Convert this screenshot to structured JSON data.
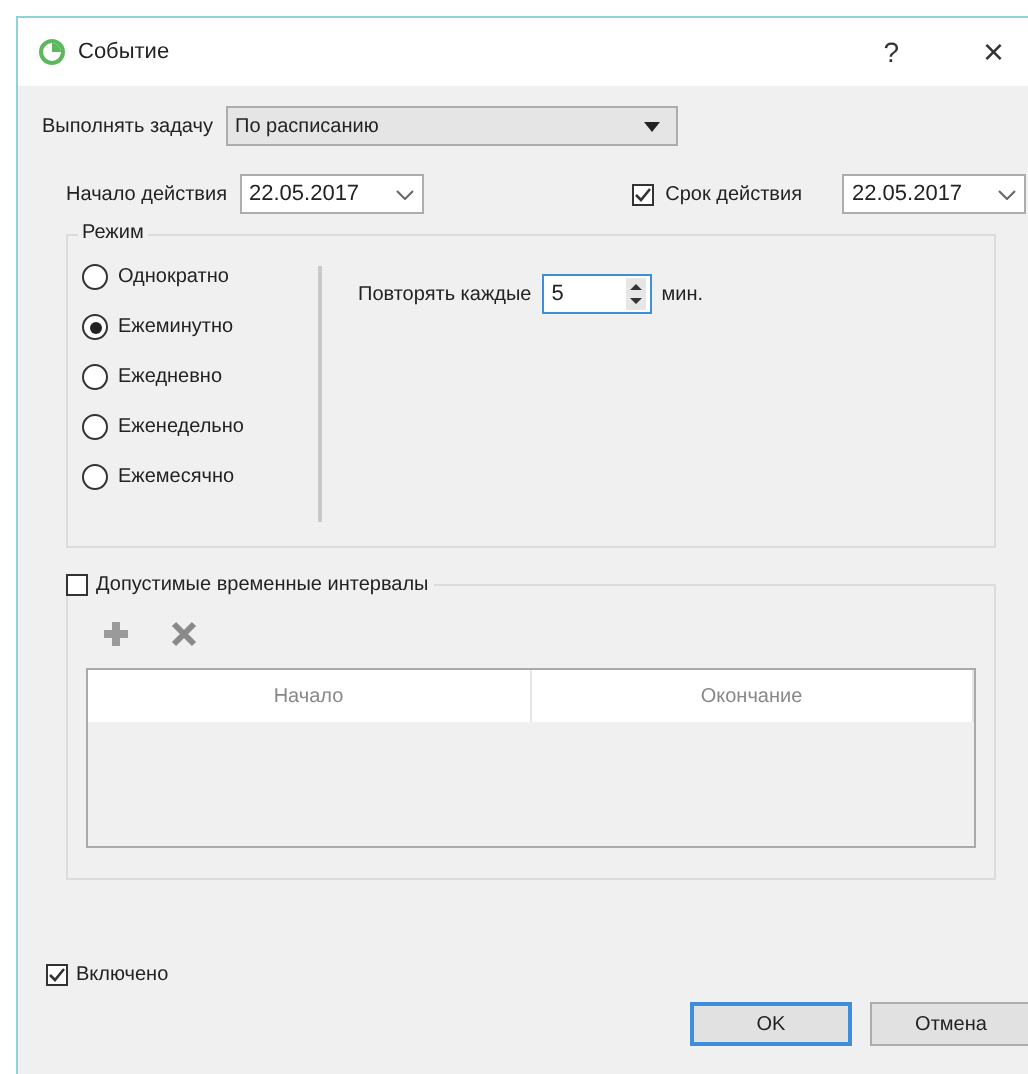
{
  "window": {
    "title": "Событие"
  },
  "title_buttons": [
    "?",
    "×"
  ],
  "task": {
    "label": "Выполнять задачу",
    "value": "По расписанию"
  },
  "start": {
    "label": "Начало действия",
    "value": "22.05.2017"
  },
  "expiry": {
    "label": "Срок действия",
    "checked": true,
    "value": "22.05.2017"
  },
  "mode": {
    "title": "Режим",
    "options": [
      {
        "label": "Однократно",
        "selected": false
      },
      {
        "label": "Ежеминутно",
        "selected": true
      },
      {
        "label": "Ежедневно",
        "selected": false
      },
      {
        "label": "Еженедельно",
        "selected": false
      },
      {
        "label": "Ежемесячно",
        "selected": false
      }
    ],
    "repeat": {
      "label": "Повторять каждые",
      "value": "5",
      "unit": "мин."
    }
  },
  "intervals": {
    "label": "Допустимые временные интервалы",
    "checked": false,
    "columns": [
      "Начало",
      "Окончание"
    ]
  },
  "enabled": {
    "label": "Включено",
    "checked": true
  },
  "buttons": [
    "OK",
    "Отмена"
  ]
}
